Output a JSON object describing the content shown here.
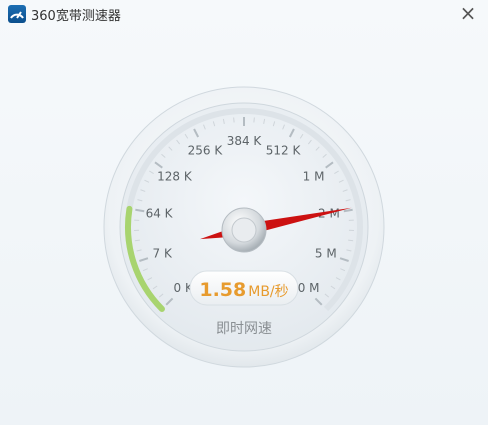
{
  "window": {
    "title": "360宽带测速器",
    "app_icon": "speedometer-icon",
    "close_glyph": "×",
    "close_icon": "close-icon"
  },
  "gauge": {
    "scale_labels": [
      "0 K",
      "7 K",
      "64 K",
      "128 K",
      "256 K",
      "384 K",
      "512 K",
      "1 M",
      "2 M",
      "5 M",
      "10 M"
    ],
    "needle_position": 7.9,
    "progress_fraction": 0.2,
    "readout_value": "1.58",
    "readout_unit": "MB/秒",
    "caption": "即时网速",
    "accent_color": "#a8d46f",
    "needle_color": "#cc1111",
    "value_color": "#e79b2e"
  }
}
